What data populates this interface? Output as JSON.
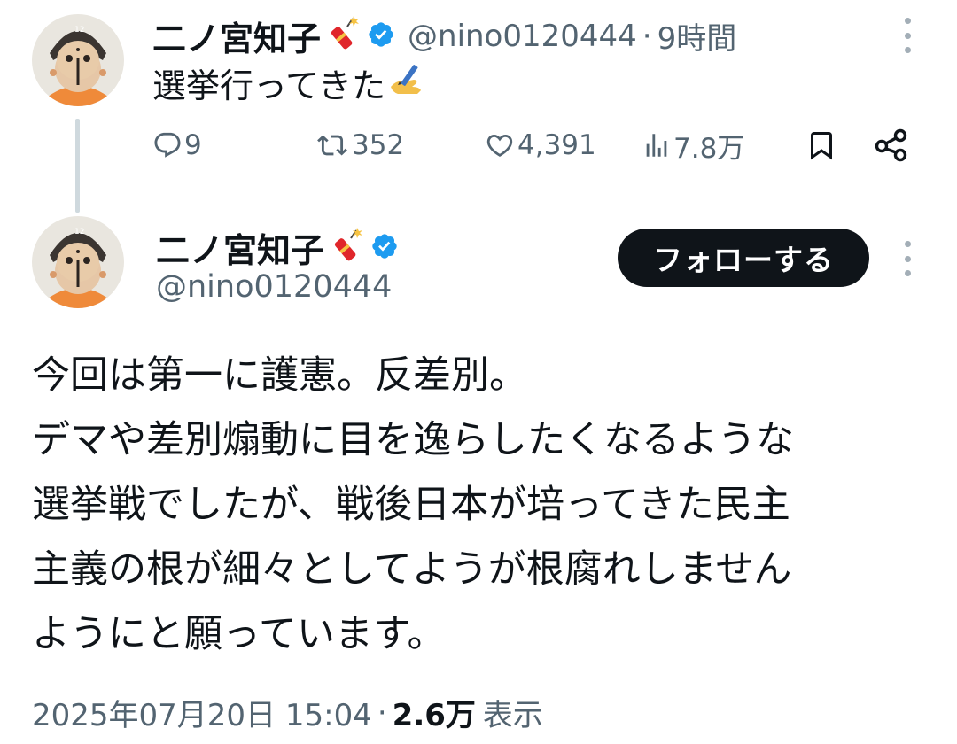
{
  "reply_tweet": {
    "author": {
      "display_name": "二ノ宮知子",
      "handle": "@nino0120444",
      "verified_color": "#1d9bf0"
    },
    "separator": "·",
    "time_ago": "9時間",
    "text": "選挙行ってきた",
    "emoji_icon": "writing-hand-icon",
    "actions": {
      "replies": "9",
      "retweets": "352",
      "likes": "4,391",
      "views": "7.8万"
    }
  },
  "main_tweet": {
    "author": {
      "display_name": "二ノ宮知子",
      "handle": "@nino0120444",
      "verified_color": "#1d9bf0"
    },
    "follow_label": "フォローする",
    "text_lines": [
      "今回は第一に護憲。反差別。",
      "デマや差別煽動に目を逸らしたくなるような",
      "選挙戦でしたが、戦後日本が培ってきた民主",
      "主義の根が細々としてようが根腐れしません",
      "ようにと願っています。"
    ],
    "timestamp": "2025年07月20日 15:04",
    "separator": "·",
    "views_count": "2.6万",
    "views_label": "表示"
  },
  "icons": {
    "reply": "comment-icon",
    "retweet": "retweet-icon",
    "like": "heart-icon",
    "views": "bar-chart-icon",
    "bookmark": "bookmark-icon",
    "share": "share-icon",
    "more": "more-vertical-icon",
    "name_emoji": "firecracker-icon"
  },
  "colors": {
    "text_primary": "#0f1419",
    "text_secondary": "#536471",
    "verified": "#1d9bf0",
    "follow_button_bg": "#0f1419",
    "thread_line": "#cfd9de"
  }
}
